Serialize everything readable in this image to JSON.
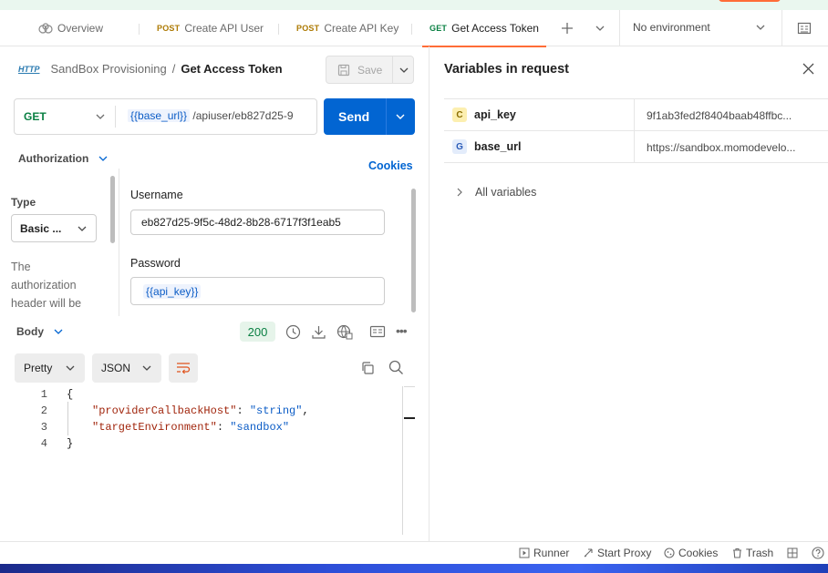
{
  "tabs": [
    {
      "method": "",
      "label": "Overview"
    },
    {
      "method": "POST",
      "label": "Create API User"
    },
    {
      "method": "POST",
      "label": "Create API Key"
    },
    {
      "method": "GET",
      "label": "Get Access Token"
    }
  ],
  "environment": {
    "selected": "No environment"
  },
  "breadcrumb": {
    "icon_text": "HTTP",
    "collection": "SandBox Provisioning",
    "separator": "/",
    "request": "Get Access Token"
  },
  "toolbar": {
    "save_label": "Save"
  },
  "request": {
    "method": "GET",
    "url_var": "{{base_url}}",
    "url_rest": "/apiuser/eb827d25-9",
    "send_label": "Send"
  },
  "auth": {
    "section_label": "Authorization",
    "cookies_label": "Cookies",
    "type_label": "Type",
    "type_value": "Basic ...",
    "description": [
      "The",
      "authorization",
      "header will be"
    ],
    "username_label": "Username",
    "username_value": "eb827d25-9f5c-48d2-8b28-6717f3f1eab5",
    "password_label": "Password",
    "password_value": "{{api_key}}"
  },
  "response": {
    "body_label": "Body",
    "status": "200",
    "format_pretty": "Pretty",
    "format_json": "JSON",
    "lines": [
      {
        "n": "1",
        "text": "{"
      },
      {
        "n": "2",
        "key": "\"providerCallbackHost\"",
        "sep": ": ",
        "val": "\"string\"",
        "tail": ","
      },
      {
        "n": "3",
        "key": "\"targetEnvironment\"",
        "sep": ": ",
        "val": "\"sandbox\"",
        "tail": ""
      },
      {
        "n": "4",
        "text": "}"
      }
    ]
  },
  "variables_panel": {
    "title": "Variables in request",
    "vars": [
      {
        "scope": "C",
        "name": "api_key",
        "value": "9f1ab3fed2f8404baab48ffbc...",
        "scope_color": "#fcefb0",
        "scope_text": "#8a6d00"
      },
      {
        "scope": "G",
        "name": "base_url",
        "value": "https://sandbox.momodevelo...",
        "scope_color": "#e3ecfb",
        "scope_text": "#2a5bb8"
      }
    ],
    "all_variables": "All variables"
  },
  "statusbar": {
    "runner": "Runner",
    "start_proxy": "Start Proxy",
    "cookies": "Cookies",
    "trash": "Trash"
  }
}
